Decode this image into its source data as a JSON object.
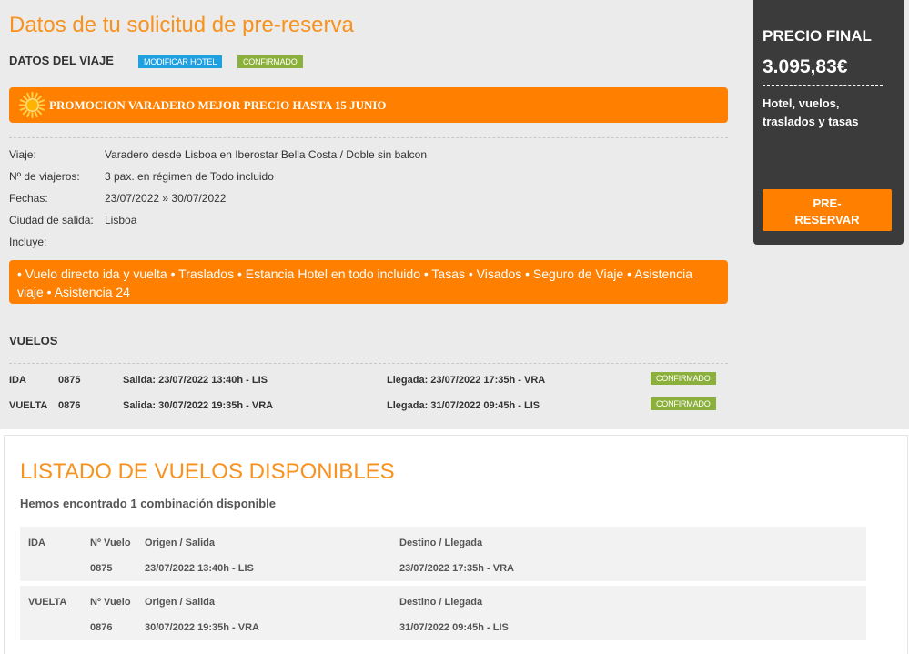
{
  "header": {
    "title": "Datos de tu solicitud de pre-reserva",
    "section_label": "DATOS DEL VIAJE",
    "modify_hotel_label": "MODIFICAR HOTEL",
    "status_badge": "CONFIRMADO"
  },
  "promo": {
    "text": "PROMOCION VARADERO MEJOR PRECIO HASTA 15 JUNIO",
    "icon": "sun-icon"
  },
  "trip": {
    "rows": [
      {
        "label": "Viaje:",
        "value": "Varadero desde Lisboa en Iberostar Bella Costa / Doble sin balcon"
      },
      {
        "label": "Nº de viajeros:",
        "value": "3 pax. en régimen de Todo incluido"
      },
      {
        "label": "Fechas:",
        "value": "23/07/2022 » 30/07/2022"
      },
      {
        "label": "Ciudad de salida:",
        "value": "Lisboa"
      },
      {
        "label": "Incluye:",
        "value": ""
      }
    ],
    "includes": "• Vuelo directo ida y vuelta • Traslados • Estancia Hotel en todo incluido • Tasas • Visados • Seguro de Viaje • Asistencia viaje • Asistencia 24"
  },
  "flights": {
    "title": "VUELOS",
    "rows": [
      {
        "type": "IDA",
        "number": "0875",
        "departure": "Salida: 23/07/2022 13:40h - LIS",
        "arrival": "Llegada: 23/07/2022 17:35h - VRA",
        "status": "CONFIRMADO"
      },
      {
        "type": "VUELTA",
        "number": "0876",
        "departure": "Salida: 30/07/2022 19:35h - VRA",
        "arrival": "Llegada: 31/07/2022 09:45h - LIS",
        "status": "CONFIRMADO"
      }
    ]
  },
  "sidebar": {
    "price_label": "PRECIO FINAL",
    "price": "3.095,83€",
    "description": "Hotel, vuelos, traslados y tasas",
    "button_label": "PRE-\nRESERVAR"
  },
  "available": {
    "title": "LISTADO DE VUELOS DISPONIBLES",
    "found_text": "Hemos encontrado 1 combinación disponible",
    "headers": {
      "number": "Nº Vuelo",
      "origin": "Origen / Salida",
      "destination": "Destino / Llegada"
    },
    "blocks": [
      {
        "type": "IDA",
        "number": "0875",
        "origin": "23/07/2022 13:40h - LIS",
        "destination": "23/07/2022 17:35h - VRA"
      },
      {
        "type": "VUELTA",
        "number": "0876",
        "origin": "30/07/2022 19:35h - VRA",
        "destination": "31/07/2022 09:45h - LIS"
      }
    ]
  },
  "colors": {
    "accent": "#f7921e",
    "orange": "#ff8000",
    "blue_badge": "#1fa0e0",
    "green_badge": "#8cb03c",
    "sidebar_bg": "#3b3b3b"
  }
}
